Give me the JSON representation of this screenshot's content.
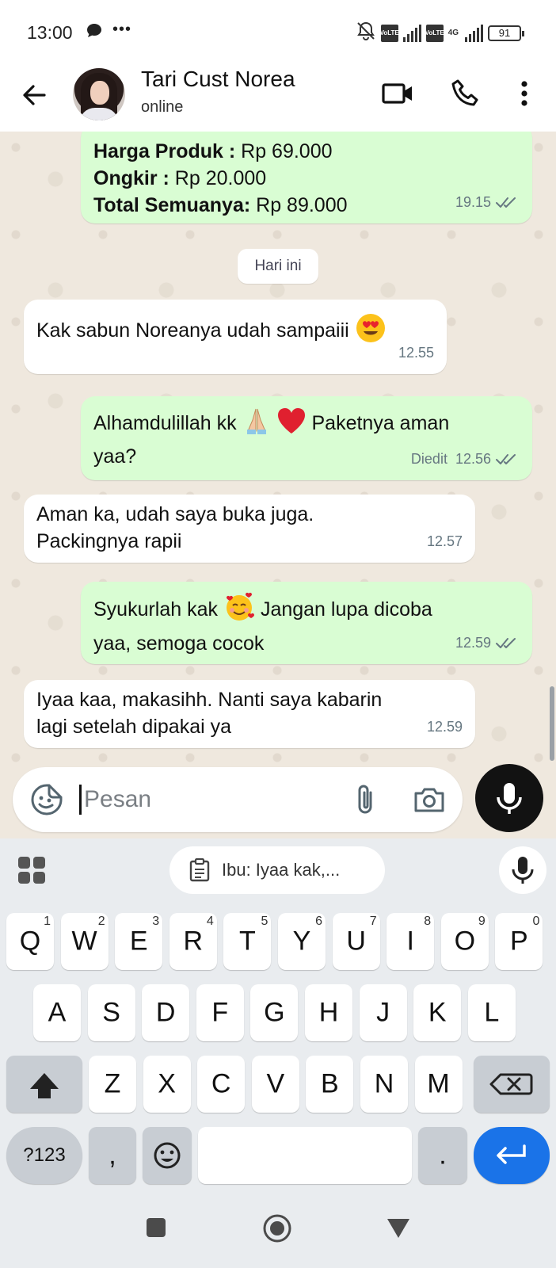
{
  "status_bar": {
    "time": "13:00",
    "overflow_dots": "•••",
    "battery": "91",
    "network": "4G"
  },
  "header": {
    "contact_name": "Tari Cust Norea",
    "status": "online"
  },
  "messages": [
    {
      "direction": "out",
      "lines": [
        {
          "bold": "Harga Produk :",
          "text": " Rp 69.000"
        },
        {
          "bold": "Ongkir :",
          "text": " Rp 20.000"
        },
        {
          "bold": "Total Semuanya:",
          "text": " Rp 89.000"
        }
      ],
      "time": "19.15",
      "read": true
    },
    {
      "direction": "in",
      "text": "Kak sabun Noreanya udah sampaiii",
      "emoji": "heart-eyes",
      "time": "12.55"
    },
    {
      "direction": "out",
      "text_before": "Alhamdulillah kk",
      "emoji": [
        "praying-hands",
        "red-heart"
      ],
      "text_after": "Paketnya aman",
      "line2": "yaa?",
      "edited_label": "Diedit",
      "time": "12.56",
      "read": true
    },
    {
      "direction": "in",
      "line1": "Aman ka, udah saya buka juga.",
      "line2": "Packingnya rapii",
      "time": "12.57"
    },
    {
      "direction": "out",
      "text_before": "Syukurlah kak",
      "emoji": "smiling-face-with-hearts",
      "text_after": "Jangan lupa dicoba",
      "line2": "yaa, semoga cocok",
      "time": "12.59",
      "read": true
    },
    {
      "direction": "in",
      "line1": "Iyaa kaa, makasihh. Nanti saya kabarin",
      "line2": "lagi setelah dipakai ya",
      "time": "12.59"
    }
  ],
  "date_chip": "Hari ini",
  "composer": {
    "placeholder": "Pesan"
  },
  "keyboard": {
    "clipboard_suggestion": "Ibu: Iyaa kak,...",
    "row1": [
      {
        "k": "Q",
        "h": "1"
      },
      {
        "k": "W",
        "h": "2"
      },
      {
        "k": "E",
        "h": "3"
      },
      {
        "k": "R",
        "h": "4"
      },
      {
        "k": "T",
        "h": "5"
      },
      {
        "k": "Y",
        "h": "6"
      },
      {
        "k": "U",
        "h": "7"
      },
      {
        "k": "I",
        "h": "8"
      },
      {
        "k": "O",
        "h": "9"
      },
      {
        "k": "P",
        "h": "0"
      }
    ],
    "row2": [
      "A",
      "S",
      "D",
      "F",
      "G",
      "H",
      "J",
      "K",
      "L"
    ],
    "row3": [
      "Z",
      "X",
      "C",
      "V",
      "B",
      "N",
      "M"
    ],
    "symbols_key": "?123",
    "comma_key": ",",
    "period_key": "."
  },
  "colors": {
    "outgoing_bubble": "#d9fdd3",
    "incoming_bubble": "#ffffff",
    "chat_background": "#efe8de",
    "read_ticks": "#53bdeb",
    "enter_key": "#1a73e8"
  }
}
